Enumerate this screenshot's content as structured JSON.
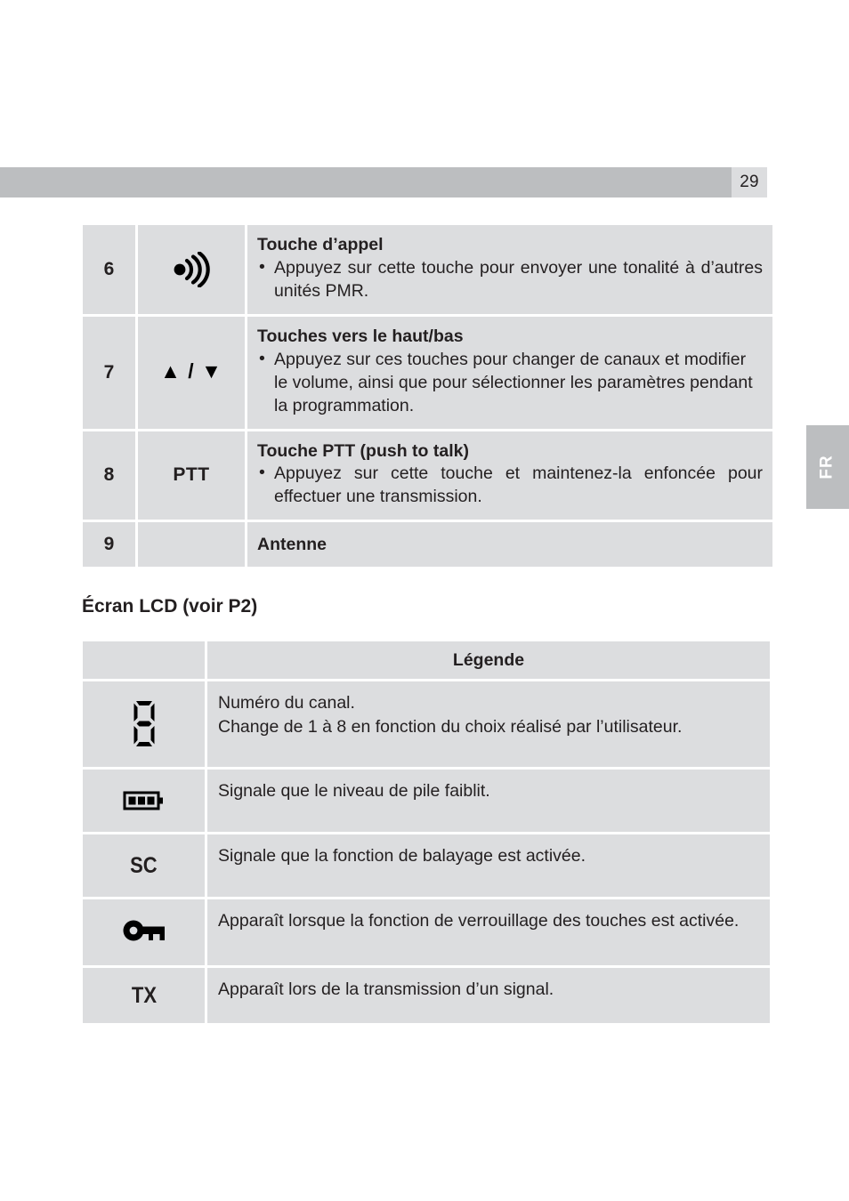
{
  "header": {
    "page_number": "29",
    "band_color": "#bcbec0",
    "page_box_color": "#dcdddf"
  },
  "side_tab": {
    "label": "FR",
    "background": "#bcbec0",
    "text_color": "#ffffff"
  },
  "controls_table": {
    "rows": [
      {
        "number": "6",
        "icon": "call-tone-icon",
        "icon_label": "",
        "title": "Touche d’appel",
        "bullet": "Appuyez sur cette touche pour envoyer une tonalité à d’autres unités PMR.",
        "justified": true
      },
      {
        "number": "7",
        "icon": "up-down-arrows-icon",
        "icon_label": "▲ / ▼",
        "title": "Touches vers le haut/bas",
        "bullet": "Appuyez sur ces touches pour changer de canaux et modifier le volume, ainsi que pour sélectionner les paramètres pendant la programmation.",
        "justified": false
      },
      {
        "number": "8",
        "icon": "ptt-text-icon",
        "icon_label": "PTT",
        "title": "Touche PTT (push to talk)",
        "bullet": "Appuyez sur cette touche et maintenez-la enfoncée pour effectuer une transmission.",
        "justified": true
      },
      {
        "number": "9",
        "icon": "",
        "icon_label": "",
        "title": "Antenne",
        "bullet": "",
        "justified": false
      }
    ]
  },
  "lcd_section": {
    "heading": "Écran LCD (voir P2)",
    "table": {
      "header": {
        "symbol_column": "",
        "legend_column": "Légende"
      },
      "rows": [
        {
          "icon": "seven-segment-eight-icon",
          "icon_label": "",
          "text": "Numéro du canal.\nChange de 1 à 8 en fonction du choix réalisé par l’utilisateur.",
          "line1": "Numéro du canal.",
          "line2": "Change de 1 à 8 en fonction du choix réalisé par l’utilisateur.",
          "justified": true
        },
        {
          "icon": "battery-low-icon",
          "icon_label": "",
          "text": "Signale que le niveau de pile faiblit.",
          "justified": false
        },
        {
          "icon": "scan-sc-icon",
          "icon_label": "SC",
          "text": "Signale que la fonction de balayage est activée.",
          "justified": false
        },
        {
          "icon": "key-lock-icon",
          "icon_label": "",
          "text": "Apparaît lorsque la fonction de verrouillage des touches est activée.",
          "justified": true
        },
        {
          "icon": "transmit-tx-icon",
          "icon_label": "TX",
          "text": "Apparaît lors de la transmission d’un signal.",
          "justified": false
        }
      ]
    }
  },
  "colors": {
    "cell_background": "#dcdddf",
    "text": "#231f20",
    "page_background": "#ffffff"
  }
}
